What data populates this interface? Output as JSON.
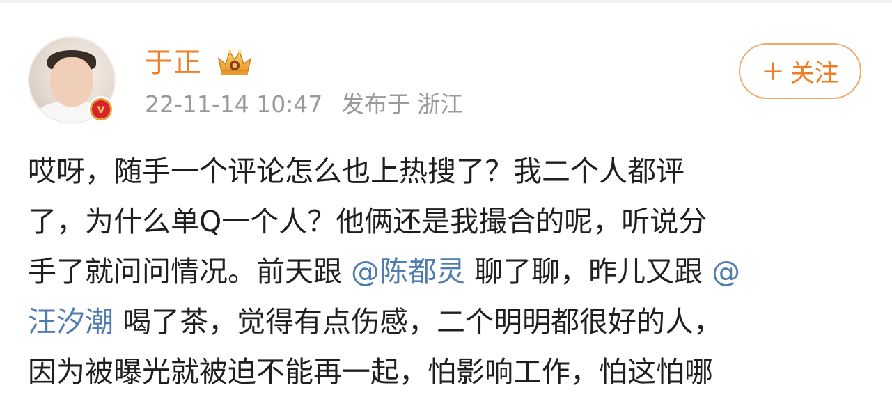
{
  "post": {
    "author": {
      "name": "于正",
      "avatar_icon": "user-avatar",
      "verified_icon": "verified-badge-icon",
      "verified_mark": "v",
      "vip_icon": "vip-crown-icon"
    },
    "timestamp": "22-11-14 10:47",
    "location_label": "发布于 浙江",
    "follow": {
      "plus": "+",
      "label": "关注"
    },
    "lines": [
      {
        "parts": [
          {
            "text": "哎呀，随手一个评论怎么也上热搜了？我二个人都评",
            "mention": false
          }
        ]
      },
      {
        "parts": [
          {
            "text": "了，为什么单Q一个人？他俩还是我撮合的呢，听说分",
            "mention": false
          }
        ]
      },
      {
        "parts": [
          {
            "text": "手了就问问情况。前天跟 ",
            "mention": false
          },
          {
            "text": "@陈都灵",
            "mention": true
          },
          {
            "text": " 聊了聊，昨儿又跟 ",
            "mention": false
          },
          {
            "text": "@",
            "mention": true
          }
        ]
      },
      {
        "parts": [
          {
            "text": "汪汐潮",
            "mention": true
          },
          {
            "text": " 喝了茶，觉得有点伤感，二个明明都很好的人，",
            "mention": false
          }
        ]
      },
      {
        "parts": [
          {
            "text": "因为被曝光就被迫不能再一起，怕影响工作，怕这怕哪",
            "mention": false
          }
        ]
      }
    ]
  },
  "colors": {
    "username": "#f17e25",
    "meta": "#9a9a9a",
    "mention": "#507daf",
    "follow_border": "#f2a76b",
    "follow_text": "#ef7d24",
    "body_text": "#1f1f1f"
  }
}
